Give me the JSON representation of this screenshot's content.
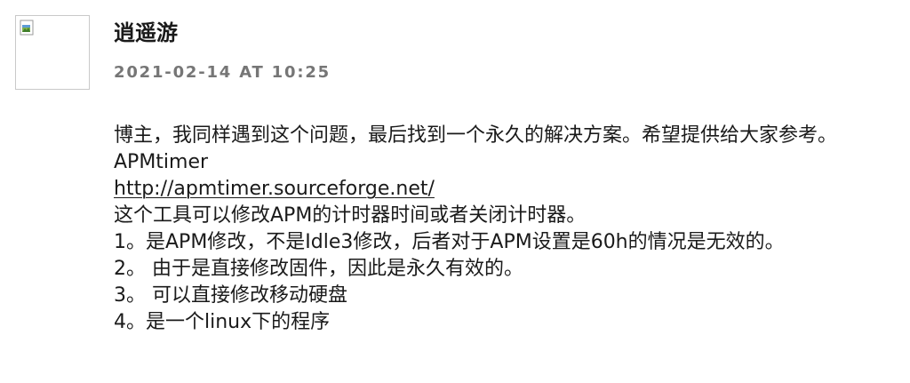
{
  "comment": {
    "author": "逍遥游",
    "date": "2021-02-14 AT 10:25",
    "avatar_icon": "broken-image-icon",
    "body": {
      "line1": "博主，我同样遇到这个问题，最后找到一个永久的解决方案。希望提供给大家参考。",
      "line2": "APMtimer",
      "link": "http://apmtimer.sourceforge.net/",
      "line4": "这个工具可以修改APM的计时器时间或者关闭计时器。",
      "line5": "1。是APM修改，不是Idle3修改，后者对于APM设置是60h的情况是无效的。",
      "line6": "2。 由于是直接修改固件，因此是永久有效的。",
      "line7": "3。 可以直接修改移动硬盘",
      "line8": "4。是一个linux下的程序"
    }
  }
}
